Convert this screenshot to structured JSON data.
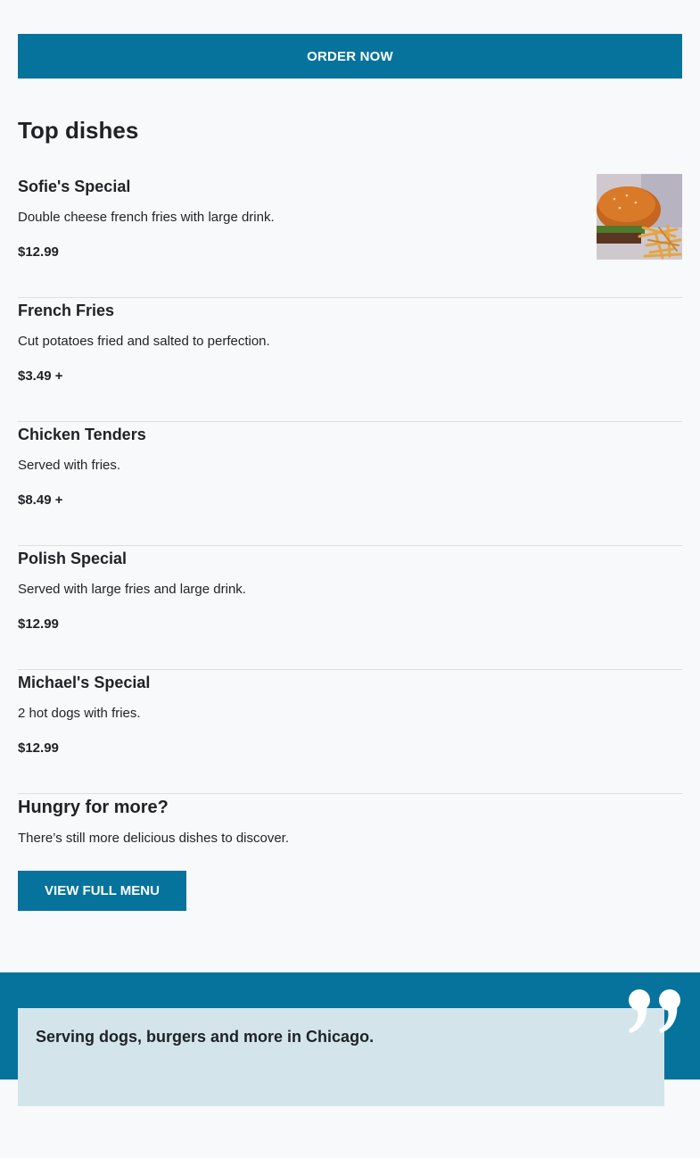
{
  "order_button": {
    "label": "ORDER NOW"
  },
  "top_dishes": {
    "title": "Top dishes",
    "items": [
      {
        "name": "Sofie's Special",
        "description": "Double cheese french fries with large drink.",
        "price": "$12.99"
      },
      {
        "name": "French Fries",
        "description": "Cut potatoes fried and salted to perfection.",
        "price": "$3.49 +"
      },
      {
        "name": "Chicken Tenders",
        "description": "Served with fries.",
        "price": "$8.49 +"
      },
      {
        "name": "Polish Special",
        "description": "Served with large fries and large drink.",
        "price": "$12.99"
      },
      {
        "name": "Michael's Special",
        "description": "2 hot dogs with fries.",
        "price": "$12.99"
      }
    ]
  },
  "more": {
    "title": "Hungry for more?",
    "text": "There’s still more delicious dishes to discover.",
    "button_label": "VIEW FULL MENU"
  },
  "testimonial": {
    "text": "Serving dogs, burgers and more in Chicago."
  },
  "colors": {
    "accent": "#06739c",
    "quote_box": "#d3e5eb",
    "text": "#1f2226",
    "divider": "#dcdfe2"
  },
  "icons": {
    "quote": "closing-quote-icon",
    "dish_photo": "burger-fries-photo"
  }
}
